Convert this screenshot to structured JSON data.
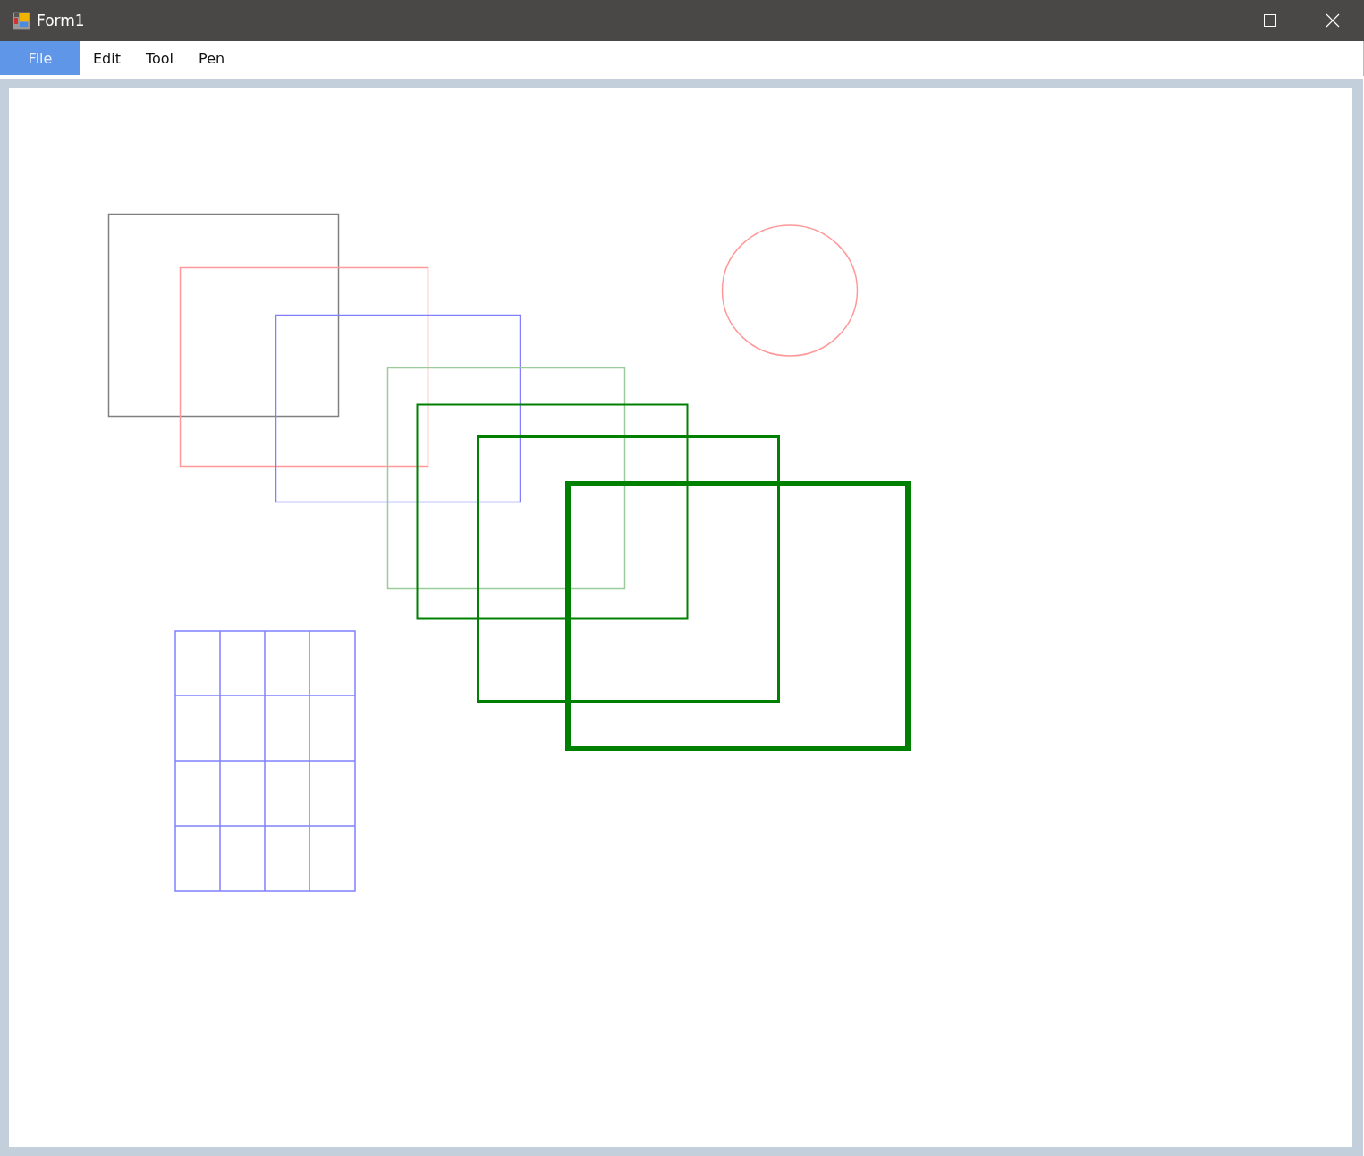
{
  "window": {
    "title": "Form1"
  },
  "menu": [
    {
      "label": "File",
      "selected": true
    },
    {
      "label": "Edit",
      "selected": false
    },
    {
      "label": "Tool",
      "selected": false
    },
    {
      "label": "Pen",
      "selected": false
    }
  ]
}
